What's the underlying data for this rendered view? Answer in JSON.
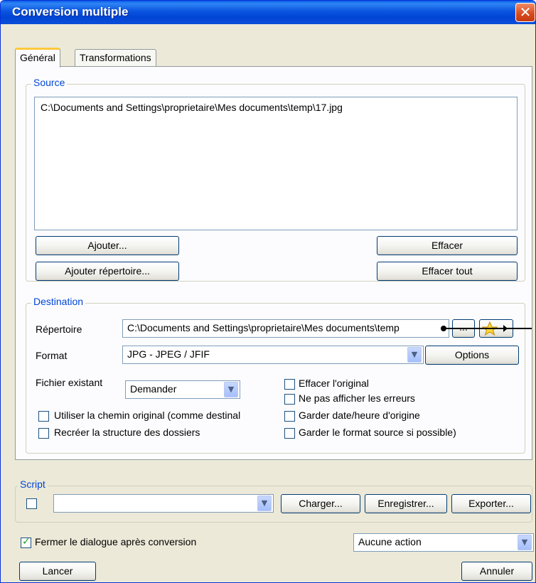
{
  "window": {
    "title": "Conversion multiple",
    "close_glyph": "✕"
  },
  "tabs": [
    {
      "label": "Général",
      "active": true
    },
    {
      "label": "Transformations",
      "active": false
    }
  ],
  "source": {
    "group_label": "Source",
    "files": [
      "C:\\Documents and Settings\\proprietaire\\Mes documents\\temp\\17.jpg"
    ],
    "add_label": "Ajouter...",
    "add_folder_label": "Ajouter répertoire...",
    "clear_label": "Effacer",
    "clear_all_label": "Effacer tout"
  },
  "destination": {
    "group_label": "Destination",
    "folder_label": "Répertoire",
    "folder_value": "C:\\Documents and Settings\\proprietaire\\Mes documents\\temp",
    "browse_label": "...",
    "favorites_icon": "star-icon",
    "format_label": "Format",
    "format_value": "JPG - JPEG / JFIF",
    "options_label": "Options",
    "existing_label": "Fichier existant",
    "existing_value": "Demander",
    "checkboxes": {
      "delete_original": {
        "label": "Effacer l'original",
        "checked": false
      },
      "hide_errors": {
        "label": "Ne pas afficher les erreurs",
        "checked": false
      },
      "use_original_path": {
        "label": "Utiliser la chemin original (comme destinal",
        "checked": false
      },
      "keep_date": {
        "label": "Garder date/heure d'origine",
        "checked": false
      },
      "recreate_tree": {
        "label": "Recréer la structure des dossiers",
        "checked": false
      },
      "keep_format": {
        "label": "Garder le format source si possible)",
        "checked": false
      }
    }
  },
  "script": {
    "group_label": "Script",
    "enabled": false,
    "value": "",
    "load_label": "Charger...",
    "save_label": "Enregistrer...",
    "export_label": "Exporter..."
  },
  "footer": {
    "close_after_label": "Fermer le dialogue après conversion",
    "close_after_checked": true,
    "action_value": "Aucune action",
    "run_label": "Lancer",
    "cancel_label": "Annuler"
  },
  "colors": {
    "title_bar": "#0a54e0",
    "group_label": "#0046d5",
    "tab_highlight": "#ffc83c"
  }
}
